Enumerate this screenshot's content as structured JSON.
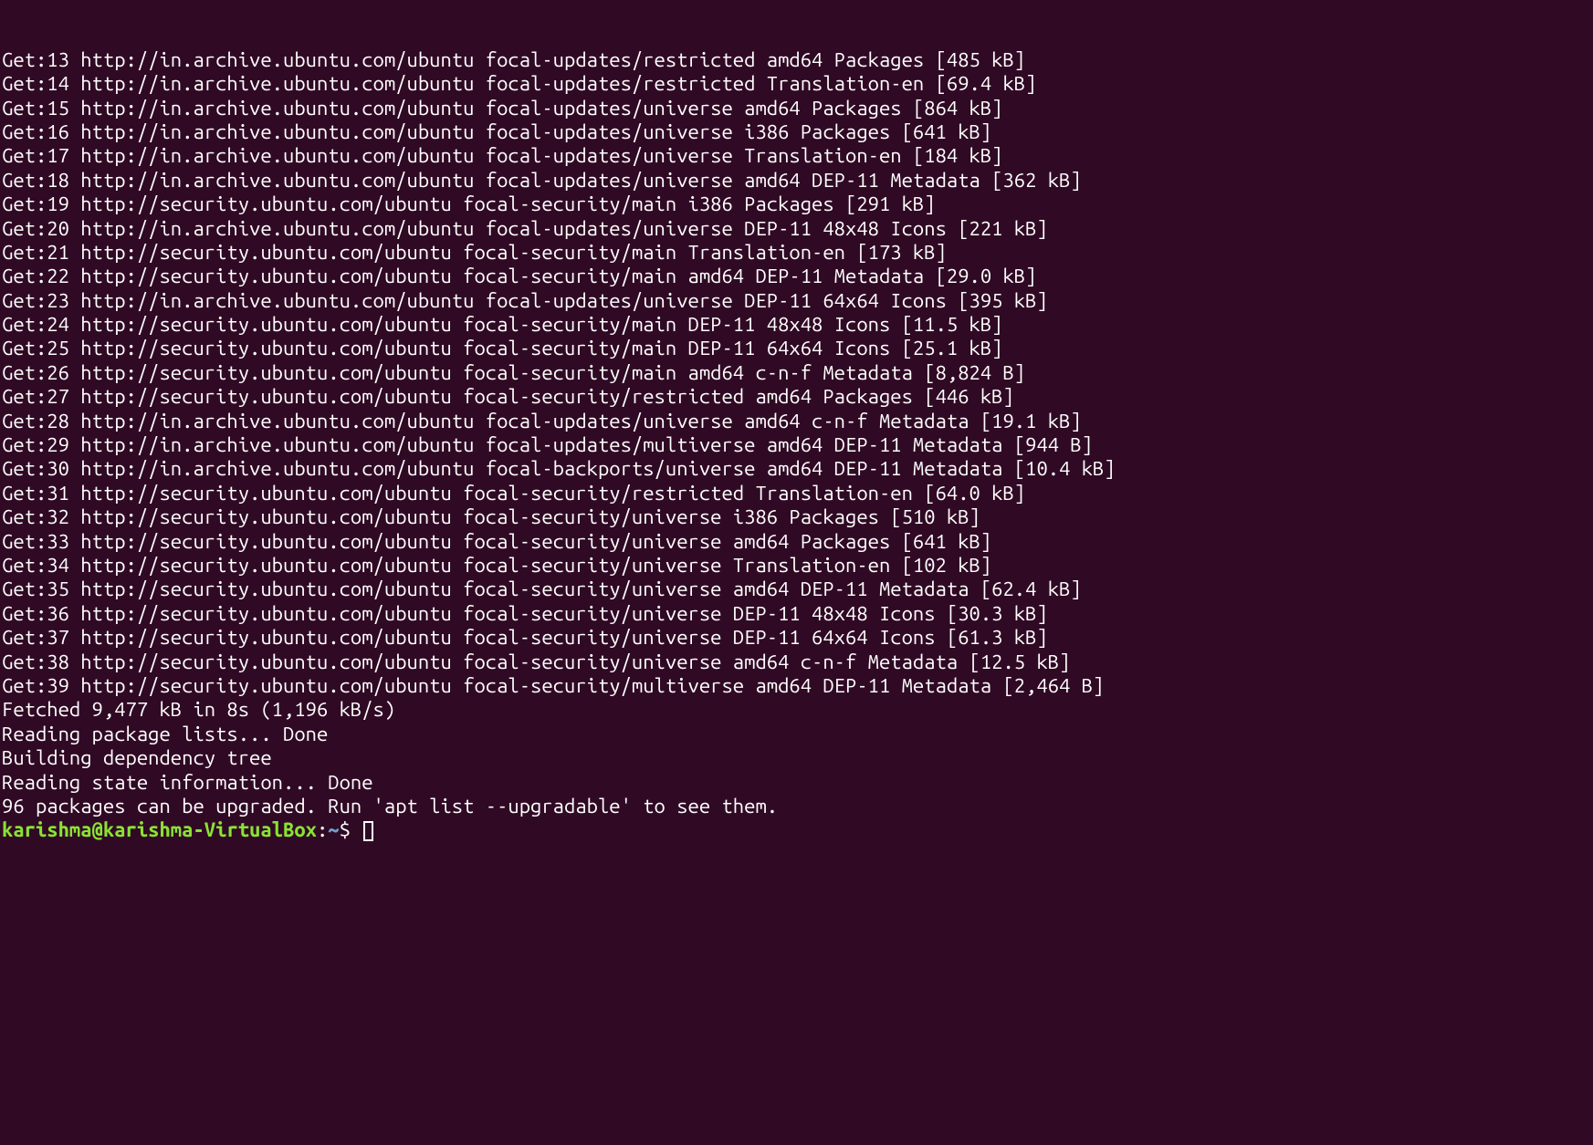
{
  "lines": [
    "Get:13 http://in.archive.ubuntu.com/ubuntu focal-updates/restricted amd64 Packages [485 kB]",
    "Get:14 http://in.archive.ubuntu.com/ubuntu focal-updates/restricted Translation-en [69.4 kB]",
    "Get:15 http://in.archive.ubuntu.com/ubuntu focal-updates/universe amd64 Packages [864 kB]",
    "Get:16 http://in.archive.ubuntu.com/ubuntu focal-updates/universe i386 Packages [641 kB]",
    "Get:17 http://in.archive.ubuntu.com/ubuntu focal-updates/universe Translation-en [184 kB]",
    "Get:18 http://in.archive.ubuntu.com/ubuntu focal-updates/universe amd64 DEP-11 Metadata [362 kB]",
    "Get:19 http://security.ubuntu.com/ubuntu focal-security/main i386 Packages [291 kB]",
    "Get:20 http://in.archive.ubuntu.com/ubuntu focal-updates/universe DEP-11 48x48 Icons [221 kB]",
    "Get:21 http://security.ubuntu.com/ubuntu focal-security/main Translation-en [173 kB]",
    "Get:22 http://security.ubuntu.com/ubuntu focal-security/main amd64 DEP-11 Metadata [29.0 kB]",
    "Get:23 http://in.archive.ubuntu.com/ubuntu focal-updates/universe DEP-11 64x64 Icons [395 kB]",
    "Get:24 http://security.ubuntu.com/ubuntu focal-security/main DEP-11 48x48 Icons [11.5 kB]",
    "Get:25 http://security.ubuntu.com/ubuntu focal-security/main DEP-11 64x64 Icons [25.1 kB]",
    "Get:26 http://security.ubuntu.com/ubuntu focal-security/main amd64 c-n-f Metadata [8,824 B]",
    "Get:27 http://security.ubuntu.com/ubuntu focal-security/restricted amd64 Packages [446 kB]",
    "Get:28 http://in.archive.ubuntu.com/ubuntu focal-updates/universe amd64 c-n-f Metadata [19.1 kB]",
    "Get:29 http://in.archive.ubuntu.com/ubuntu focal-updates/multiverse amd64 DEP-11 Metadata [944 B]",
    "Get:30 http://in.archive.ubuntu.com/ubuntu focal-backports/universe amd64 DEP-11 Metadata [10.4 kB]",
    "Get:31 http://security.ubuntu.com/ubuntu focal-security/restricted Translation-en [64.0 kB]",
    "Get:32 http://security.ubuntu.com/ubuntu focal-security/universe i386 Packages [510 kB]",
    "Get:33 http://security.ubuntu.com/ubuntu focal-security/universe amd64 Packages [641 kB]",
    "Get:34 http://security.ubuntu.com/ubuntu focal-security/universe Translation-en [102 kB]",
    "Get:35 http://security.ubuntu.com/ubuntu focal-security/universe amd64 DEP-11 Metadata [62.4 kB]",
    "Get:36 http://security.ubuntu.com/ubuntu focal-security/universe DEP-11 48x48 Icons [30.3 kB]",
    "Get:37 http://security.ubuntu.com/ubuntu focal-security/universe DEP-11 64x64 Icons [61.3 kB]",
    "Get:38 http://security.ubuntu.com/ubuntu focal-security/universe amd64 c-n-f Metadata [12.5 kB]",
    "Get:39 http://security.ubuntu.com/ubuntu focal-security/multiverse amd64 DEP-11 Metadata [2,464 B]",
    "Fetched 9,477 kB in 8s (1,196 kB/s)",
    "Reading package lists... Done",
    "Building dependency tree",
    "Reading state information... Done",
    "96 packages can be upgraded. Run 'apt list --upgradable' to see them."
  ],
  "prompt": {
    "user_host": "karishma@karishma-VirtualBox",
    "colon": ":",
    "path": "~",
    "symbol": "$ "
  }
}
